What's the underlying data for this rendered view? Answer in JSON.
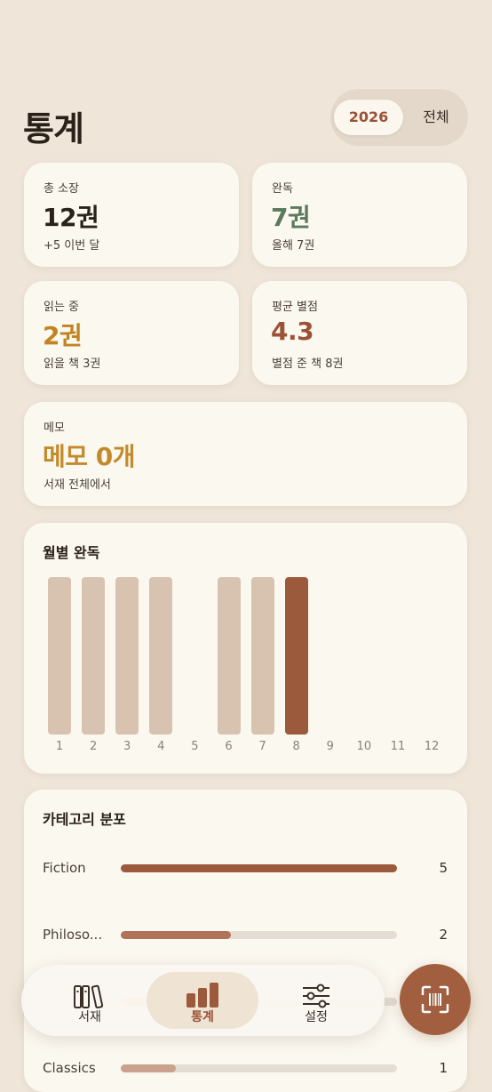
{
  "header": {
    "title": "통계"
  },
  "year_filter": {
    "options": [
      "2026",
      "전체"
    ],
    "selected": "2026"
  },
  "stats": [
    {
      "label": "총 소장",
      "value": "12권",
      "sub": "+5 이번 달",
      "color": "#2b211b"
    },
    {
      "label": "완독",
      "value": "7권",
      "sub": "올해 7권",
      "color": "#5b7a5b"
    },
    {
      "label": "읽는 중",
      "value": "2권",
      "sub": "읽을 책 3권",
      "color": "#c08422"
    },
    {
      "label": "평균 별점",
      "value": "4.3",
      "sub": "별점 준 책 8권",
      "color": "#9b5235"
    }
  ],
  "memo": {
    "label": "메모",
    "value": "메모 0개",
    "sub": "서재 전체에서",
    "color": "#c28a2a"
  },
  "monthly": {
    "title": "월별 완독",
    "chart_data": {
      "type": "bar",
      "categories": [
        "1",
        "2",
        "3",
        "4",
        "5",
        "6",
        "7",
        "8",
        "9",
        "10",
        "11",
        "12"
      ],
      "values": [
        1,
        1,
        1,
        1,
        0,
        1,
        1,
        1,
        0,
        0,
        0,
        0
      ],
      "highlight_category": "8",
      "title": "월별 완독",
      "ylim": [
        0,
        1
      ],
      "colors": {
        "bar": "#d8c3b1",
        "highlight": "#9c5a3c"
      }
    }
  },
  "categories": {
    "title": "카테고리 분포",
    "items": [
      {
        "name": "Fiction",
        "count": 5,
        "color": "#9c5a3c"
      },
      {
        "name": "Philoso...",
        "count": 2,
        "color": "#b07258"
      },
      {
        "name": "",
        "count": null,
        "color": "#efc48a"
      },
      {
        "name": "Classics",
        "count": 1,
        "color": "#c9a18c"
      }
    ],
    "max": 5
  },
  "tabbar": {
    "tabs": [
      {
        "label": "서재",
        "icon": "books-icon",
        "active": false
      },
      {
        "label": "통계",
        "icon": "bar-chart-icon",
        "active": true
      },
      {
        "label": "설정",
        "icon": "sliders-icon",
        "active": false
      }
    ]
  },
  "fab": {
    "icon": "barcode-scan-icon"
  }
}
